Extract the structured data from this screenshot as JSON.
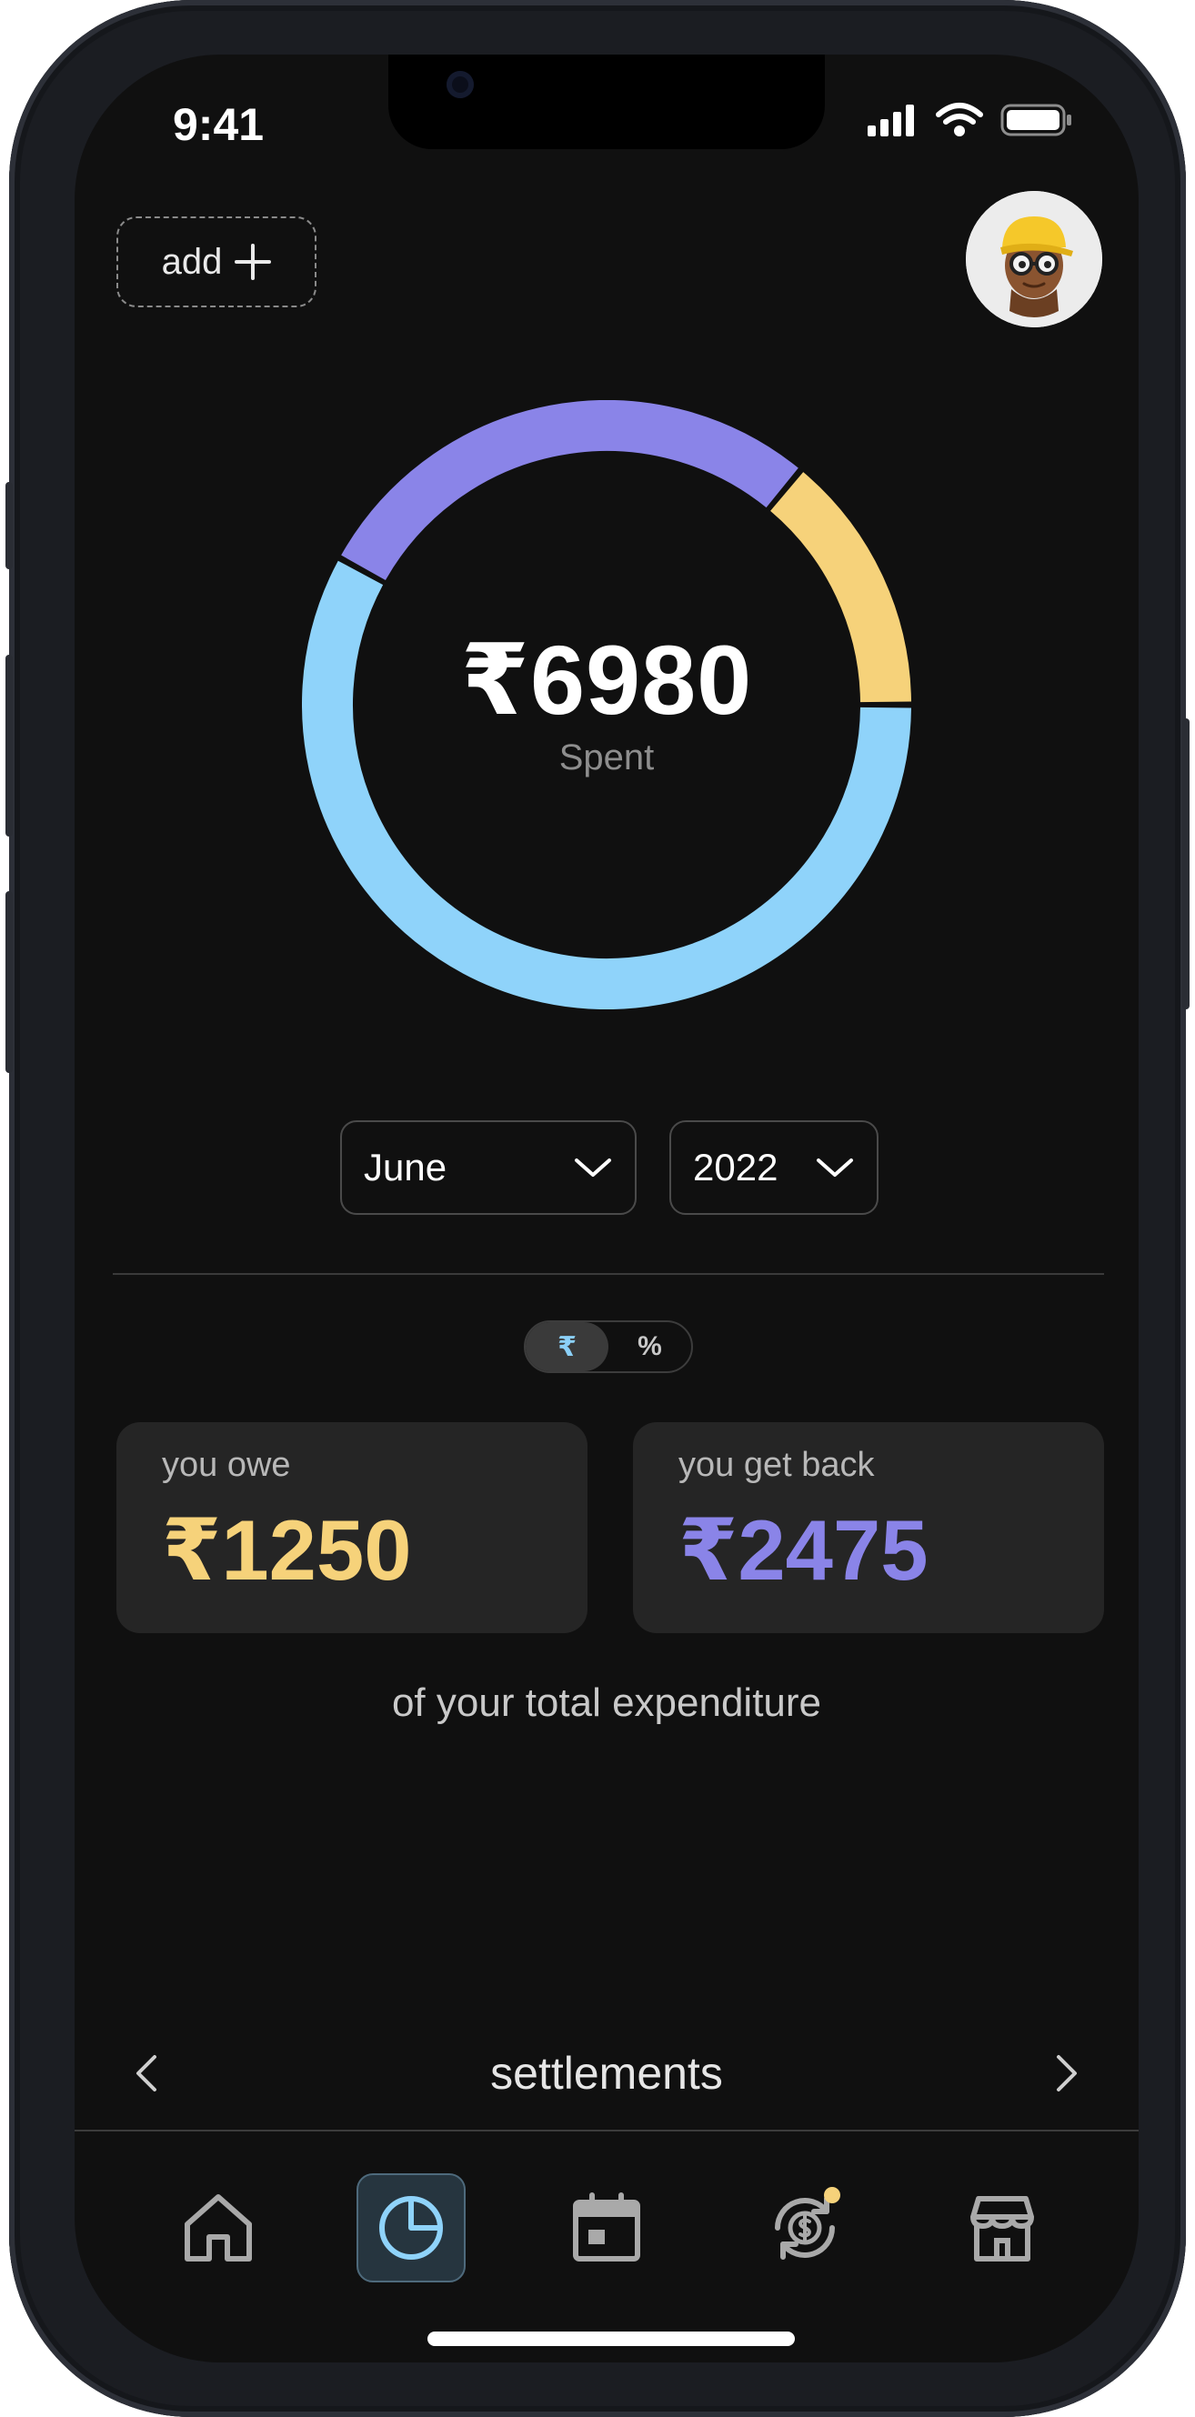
{
  "status_bar": {
    "time": "9:41"
  },
  "header": {
    "add_label": "add"
  },
  "summary": {
    "amount": "₹6980",
    "label": "Spent",
    "segments": [
      {
        "name": "segment-1",
        "fraction": 0.58,
        "color": "#8fd3fa"
      },
      {
        "name": "segment-2",
        "fraction": 0.28,
        "color": "#8a84e8"
      },
      {
        "name": "segment-3",
        "fraction": 0.14,
        "color": "#f6d27a"
      }
    ]
  },
  "filters": {
    "month": "June",
    "year": "2022"
  },
  "toggle": {
    "currency": "₹",
    "percent": "%"
  },
  "cards": {
    "owe": {
      "label": "you owe",
      "value": "₹1250",
      "color": "#f6d27a"
    },
    "get_back": {
      "label": "you get back",
      "value": "₹2475",
      "color": "#8a84e8"
    }
  },
  "caption": "of your total expenditure",
  "settlements": {
    "title": "settlements"
  },
  "nav": {
    "items": [
      "home-icon",
      "pie-chart-icon",
      "calendar-icon",
      "settlement-icon",
      "store-icon"
    ],
    "active": "pie-chart-icon",
    "badge_color": "#f6d27a"
  }
}
